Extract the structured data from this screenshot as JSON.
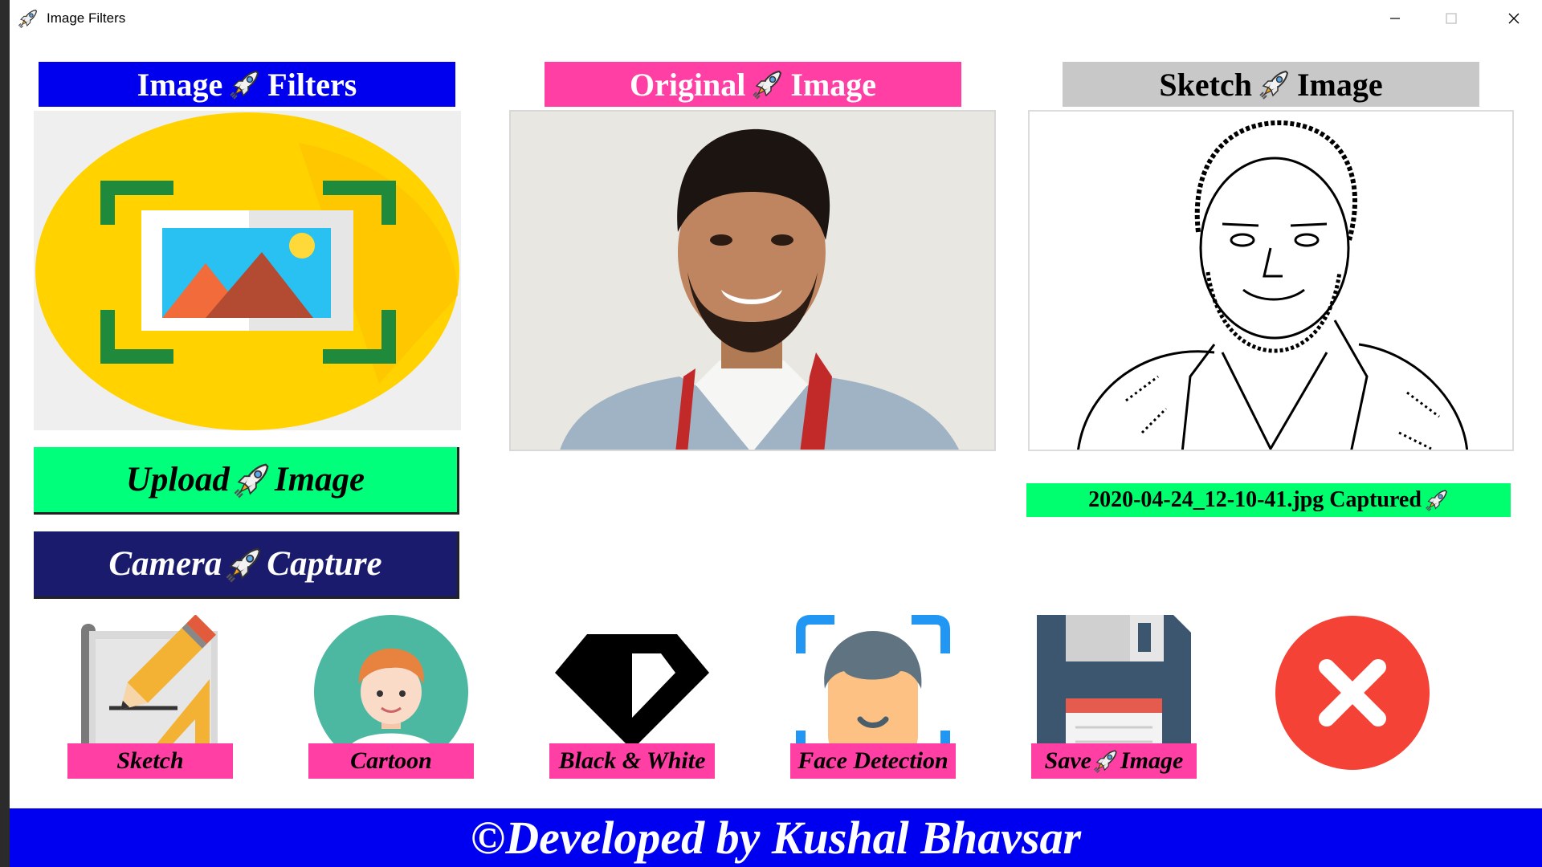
{
  "window": {
    "title": "Image Filters",
    "controls": [
      "minimize",
      "maximize",
      "close"
    ]
  },
  "headers": {
    "filters": {
      "word1": "Image",
      "word2": "Filters",
      "color": "#0000ee"
    },
    "original": {
      "word1": "Original",
      "word2": "Image",
      "color": "#ff3fa4"
    },
    "sketch": {
      "word1": "Sketch",
      "word2": "Image",
      "color": "#c8c8c8"
    }
  },
  "buttons": {
    "upload": {
      "word1": "Upload",
      "word2": "Image",
      "color": "#00ff7a"
    },
    "camera": {
      "word1": "Camera",
      "word2": "Capture",
      "color": "#1b1b6e"
    }
  },
  "status": {
    "captured_text": "2020-04-24_12-10-41.jpg Captured"
  },
  "tools": [
    {
      "label": "Sketch",
      "icon": "sketch-pencil-icon"
    },
    {
      "label": "Cartoon",
      "icon": "cartoon-boy-icon"
    },
    {
      "label": "Black & White",
      "icon": "black-white-diamond-icon"
    },
    {
      "label": "Face Detection",
      "icon": "face-detection-icon"
    },
    {
      "label_word1": "Save",
      "label_word2": "Image",
      "icon": "floppy-disk-icon"
    }
  ],
  "exit": {
    "icon": "close-circle-icon",
    "color": "#f44336"
  },
  "footer": {
    "text": "©Developed by Kushal Bhavsar",
    "color": "#0000f0"
  },
  "decorations": {
    "inline_glyph": "rocket-icon"
  }
}
